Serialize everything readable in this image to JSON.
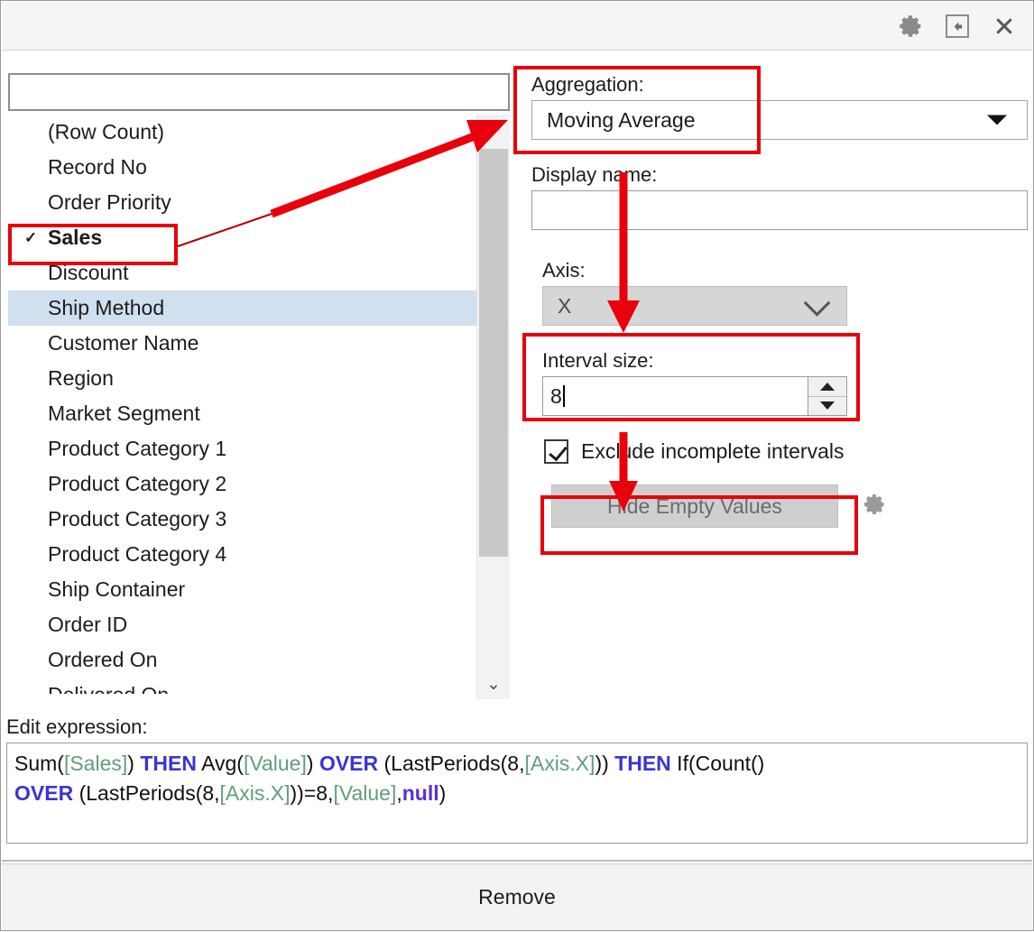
{
  "titlebar": {
    "icons": [
      {
        "name": "gear-icon",
        "label": "Settings"
      },
      {
        "name": "dock-left-icon",
        "label": "Dock"
      },
      {
        "name": "close-icon",
        "label": "Close"
      }
    ]
  },
  "search": {
    "value": "",
    "placeholder": ""
  },
  "column_list": {
    "items": [
      {
        "label": "(Row Count)",
        "checked": false,
        "hover": false
      },
      {
        "label": "Record No",
        "checked": false,
        "hover": false
      },
      {
        "label": "Order Priority",
        "checked": false,
        "hover": false
      },
      {
        "label": "Sales",
        "checked": true,
        "hover": false
      },
      {
        "label": "Discount",
        "checked": false,
        "hover": false
      },
      {
        "label": "Ship Method",
        "checked": false,
        "hover": true
      },
      {
        "label": "Customer Name",
        "checked": false,
        "hover": false
      },
      {
        "label": "Region",
        "checked": false,
        "hover": false
      },
      {
        "label": "Market Segment",
        "checked": false,
        "hover": false
      },
      {
        "label": "Product Category 1",
        "checked": false,
        "hover": false
      },
      {
        "label": "Product Category 2",
        "checked": false,
        "hover": false
      },
      {
        "label": "Product Category 3",
        "checked": false,
        "hover": false
      },
      {
        "label": "Product Category 4",
        "checked": false,
        "hover": false
      },
      {
        "label": "Ship Container",
        "checked": false,
        "hover": false
      },
      {
        "label": "Order ID",
        "checked": false,
        "hover": false
      },
      {
        "label": "Ordered On",
        "checked": false,
        "hover": false
      },
      {
        "label": "Delivered On",
        "checked": false,
        "hover": false
      }
    ],
    "check_glyph": "✓"
  },
  "scrollbar": {
    "up_glyph": "⌃",
    "down_glyph": "⌄"
  },
  "settings_panel": {
    "aggregation": {
      "label": "Aggregation:",
      "value": "Moving Average"
    },
    "display_name": {
      "label": "Display name:",
      "value": ""
    },
    "axis": {
      "label": "Axis:",
      "value": "X",
      "disabled": true
    },
    "interval_size": {
      "label": "Interval size:",
      "value": "8"
    },
    "exclude_incomplete": {
      "label": "Exclude incomplete intervals",
      "checked": true
    },
    "hide_empty_values": {
      "label": "Hide Empty Values",
      "disabled": true
    },
    "hide_empty_gear": {
      "name": "gear-icon"
    }
  },
  "expression": {
    "label": "Edit expression:",
    "plain": "Sum([Sales]) THEN Avg([Value]) OVER (LastPeriods(8,[Axis.X])) THEN If(Count() OVER (LastPeriods(8,[Axis.X]))=8,[Value],null)",
    "line1": [
      {
        "t": "Sum(",
        "c": "plain"
      },
      {
        "t": "[Sales]",
        "c": "col"
      },
      {
        "t": ") ",
        "c": "plain"
      },
      {
        "t": "THEN",
        "c": "k"
      },
      {
        "t": " Avg(",
        "c": "plain"
      },
      {
        "t": "[Value]",
        "c": "col"
      },
      {
        "t": ") ",
        "c": "plain"
      },
      {
        "t": "OVER",
        "c": "k"
      },
      {
        "t": " (LastPeriods(8,",
        "c": "plain"
      },
      {
        "t": "[Axis.X]",
        "c": "col"
      },
      {
        "t": ")) ",
        "c": "plain"
      },
      {
        "t": "THEN",
        "c": "k"
      },
      {
        "t": " If(Count()",
        "c": "plain"
      }
    ],
    "line2": [
      {
        "t": "OVER",
        "c": "k"
      },
      {
        "t": " (LastPeriods(8,",
        "c": "plain"
      },
      {
        "t": "[Axis.X]",
        "c": "col"
      },
      {
        "t": "))=8,",
        "c": "plain"
      },
      {
        "t": "[Value]",
        "c": "col"
      },
      {
        "t": ",",
        "c": "plain"
      },
      {
        "t": "null",
        "c": "nul"
      },
      {
        "t": ")",
        "c": "plain"
      }
    ]
  },
  "footer": {
    "remove_label": "Remove"
  },
  "colors": {
    "annotation_red": "#e8000b",
    "keyword_blue": "#3a34d2",
    "column_green": "#5f9e7c",
    "null_purple": "#5a2fd6",
    "hover_blue": "#cfe0ef",
    "disabled_gray": "#cfcfcf"
  }
}
